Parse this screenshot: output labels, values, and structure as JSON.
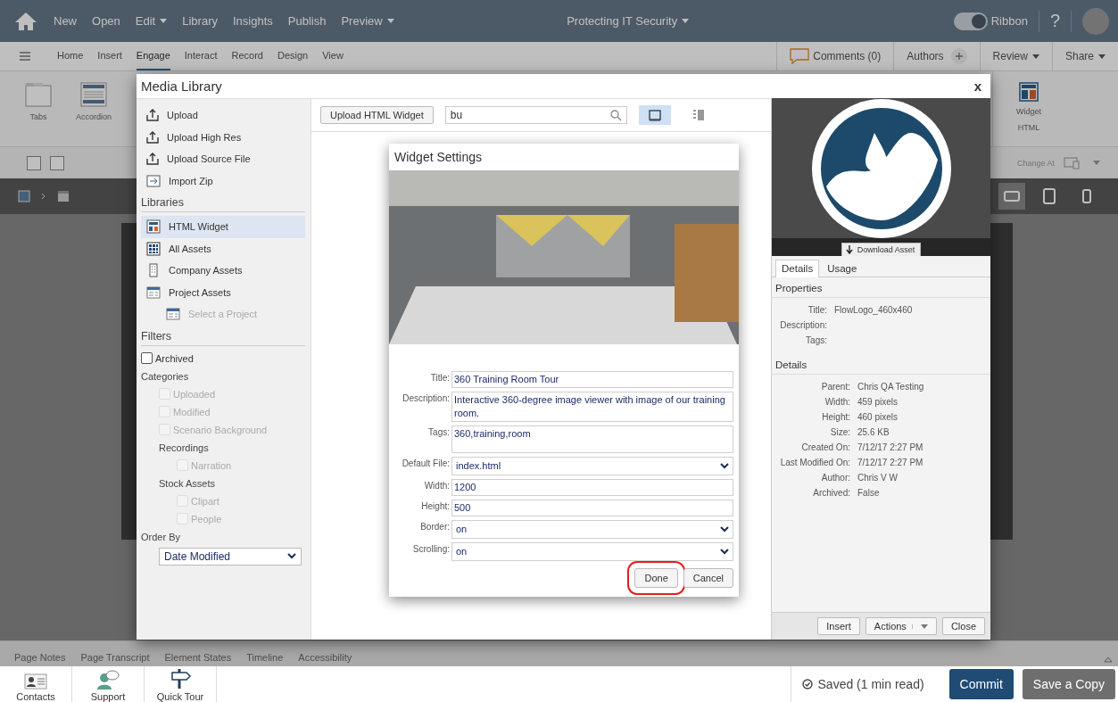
{
  "top_bar": {
    "menu": [
      {
        "label": "New",
        "dropdown": false
      },
      {
        "label": "Open",
        "dropdown": false
      },
      {
        "label": "Edit",
        "dropdown": true
      },
      {
        "label": "Library",
        "dropdown": false
      },
      {
        "label": "Insights",
        "dropdown": false
      },
      {
        "label": "Publish",
        "dropdown": false
      },
      {
        "label": "Preview",
        "dropdown": true
      }
    ],
    "title": "Protecting IT Security",
    "ribbon_toggle": {
      "label": "Ribbon",
      "on": true
    },
    "help": "?"
  },
  "nav_tabs": [
    {
      "label": "Home",
      "selected": false
    },
    {
      "label": "Insert",
      "selected": false
    },
    {
      "label": "Engage",
      "selected": true
    },
    {
      "label": "Interact",
      "selected": false
    },
    {
      "label": "Record",
      "selected": false
    },
    {
      "label": "Design",
      "selected": false
    },
    {
      "label": "View",
      "selected": false
    }
  ],
  "collab": {
    "comments": "Comments (0)",
    "authors": "Authors",
    "review": "Review",
    "share": "Share"
  },
  "ribbon": {
    "left_items": [
      {
        "label": "Tabs",
        "kind": "tabs"
      },
      {
        "label": "Accordion",
        "kind": "accordion"
      }
    ],
    "right_items": [
      {
        "label": "Widget",
        "kind": "widget"
      }
    ],
    "group_label": "HTML",
    "change_at": "Change At"
  },
  "device_modes": [
    {
      "kind": "desktop",
      "selected": true
    },
    {
      "kind": "tablet",
      "selected": false
    },
    {
      "kind": "phone",
      "selected": false
    }
  ],
  "bottom_tabs": [
    {
      "label": "Page Notes"
    },
    {
      "label": "Page Transcript"
    },
    {
      "label": "Element States"
    },
    {
      "label": "Timeline"
    },
    {
      "label": "Accessibility"
    }
  ],
  "footer": {
    "shortcuts": [
      {
        "label": "Contacts",
        "kind": "contacts"
      },
      {
        "label": "Support",
        "kind": "support"
      },
      {
        "label": "Quick Tour",
        "kind": "tour"
      }
    ],
    "status": "Saved (1 min read)",
    "commit": "Commit",
    "save_copy": "Save a Copy"
  },
  "media_library": {
    "title": "Media Library",
    "close": "x",
    "actions": [
      {
        "label": "Upload",
        "kind": "upload"
      },
      {
        "label": "Upload High Res",
        "kind": "upload"
      },
      {
        "label": "Upload Source File",
        "kind": "upload"
      },
      {
        "label": "Import Zip",
        "kind": "zip"
      }
    ],
    "libraries_heading": "Libraries",
    "libraries": [
      {
        "label": "HTML Widget",
        "kind": "widget",
        "selected": true
      },
      {
        "label": "All Assets",
        "kind": "grid",
        "selected": false
      },
      {
        "label": "Company Assets",
        "kind": "building",
        "selected": false
      },
      {
        "label": "Project Assets",
        "kind": "project",
        "selected": false,
        "children": [
          {
            "label": "Select a Project",
            "kind": "project",
            "selected": false,
            "disabled": true
          }
        ]
      }
    ],
    "filters_heading": "Filters",
    "archived": {
      "label": "Archived",
      "checked": false,
      "disabled": false
    },
    "categories_heading": "Categories",
    "categories": [
      {
        "label": "Uploaded",
        "checked": false,
        "disabled": true
      },
      {
        "label": "Modified",
        "checked": false,
        "disabled": true
      },
      {
        "label": "Scenario Background",
        "checked": false,
        "disabled": true
      }
    ],
    "groups": [
      {
        "heading": "Recordings",
        "items": [
          {
            "label": "Narration",
            "checked": false,
            "disabled": true
          }
        ]
      },
      {
        "heading": "Stock Assets",
        "items": [
          {
            "label": "Clipart",
            "checked": false,
            "disabled": true
          },
          {
            "label": "People",
            "checked": false,
            "disabled": true
          }
        ]
      }
    ],
    "order_by": {
      "label": "Order By",
      "value": "Date Modified"
    },
    "upload_button": "Upload HTML Widget",
    "search": {
      "value": "bu"
    },
    "view_modes": [
      {
        "kind": "grid",
        "selected": true
      },
      {
        "kind": "list",
        "selected": false
      }
    ],
    "widget_settings": {
      "title": "Widget Settings",
      "fields": [
        {
          "label": "Title:",
          "kind": "text",
          "value": "360 Training Room Tour"
        },
        {
          "label": "Description:",
          "kind": "textarea",
          "value": "Interactive 360-degree image viewer with image of our training room."
        },
        {
          "label": "Tags:",
          "kind": "textarea",
          "value": "360,training,room"
        },
        {
          "label": "Default File:",
          "kind": "select",
          "value": "index.html"
        },
        {
          "label": "Width:",
          "kind": "text",
          "value": "1200"
        },
        {
          "label": "Height:",
          "kind": "text",
          "value": "500"
        },
        {
          "label": "Border:",
          "kind": "select",
          "value": "on"
        },
        {
          "label": "Scrolling:",
          "kind": "select",
          "value": "on"
        }
      ],
      "buttons": [
        {
          "label": "Done",
          "highlighted": true
        },
        {
          "label": "Cancel",
          "highlighted": false
        }
      ]
    },
    "preview": {
      "download": "Download Asset",
      "tabs": [
        {
          "label": "Details",
          "selected": true
        },
        {
          "label": "Usage",
          "selected": false
        }
      ],
      "properties_heading": "Properties",
      "properties": [
        {
          "label": "Title:",
          "value": "FlowLogo_460x460"
        },
        {
          "label": "Description:"
        },
        {
          "label": "Tags:"
        }
      ],
      "details_heading": "Details",
      "details": [
        {
          "label": "Parent:",
          "value": "Chris QA Testing"
        },
        {
          "label": "Width:",
          "value": "459 pixels"
        },
        {
          "label": "Height:",
          "value": "460 pixels"
        },
        {
          "label": "Size:",
          "value": "25.6 KB"
        },
        {
          "label": "Created On:",
          "value": "7/12/17 2:27 PM"
        },
        {
          "label": "Last Modified On:",
          "value": "7/12/17 2:27 PM"
        },
        {
          "label": "Author:",
          "value": "Chris V W"
        },
        {
          "label": "Archived:",
          "value": "False"
        }
      ],
      "buttons": [
        {
          "label": "Insert",
          "kind": "plain"
        },
        {
          "label": "Actions",
          "kind": "split"
        },
        {
          "label": "Close",
          "kind": "plain"
        }
      ]
    }
  }
}
